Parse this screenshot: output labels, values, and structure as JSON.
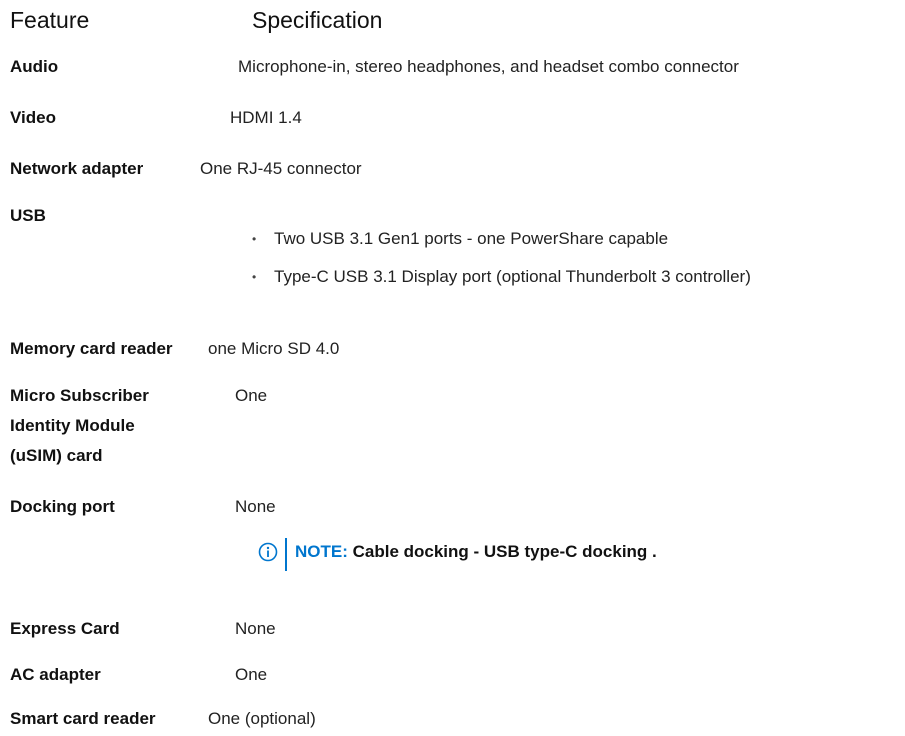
{
  "table": {
    "headers": {
      "feature": "Feature",
      "specification": "Specification"
    },
    "rows": [
      {
        "feature": "Audio",
        "spec": "Microphone-in, stereo headphones, and headset combo connector"
      },
      {
        "feature": "Video",
        "spec": "HDMI 1.4"
      },
      {
        "feature": "Network adapter",
        "spec": "One RJ-45 connector"
      },
      {
        "feature": "USB",
        "bullets": [
          "Two USB 3.1 Gen1 ports - one PowerShare capable",
          "Type-C USB 3.1 Display port (optional Thunderbolt 3 controller)"
        ]
      },
      {
        "feature": "Memory card reader",
        "spec": "one Micro SD 4.0"
      },
      {
        "feature_lines": [
          "Micro Subscriber",
          "Identity Module",
          "(uSIM) card"
        ],
        "spec": "One"
      },
      {
        "feature": "Docking port",
        "spec": "None",
        "note": {
          "label": "NOTE:",
          "text": " Cable docking - USB type-C docking ."
        }
      },
      {
        "feature": "Express Card",
        "spec": "None"
      },
      {
        "feature": "AC adapter",
        "spec": "One"
      },
      {
        "feature": "Smart card reader",
        "spec": "One (optional)"
      }
    ]
  },
  "colors": {
    "note_accent": "#0076ce"
  },
  "icons": {
    "note": "info-icon"
  }
}
